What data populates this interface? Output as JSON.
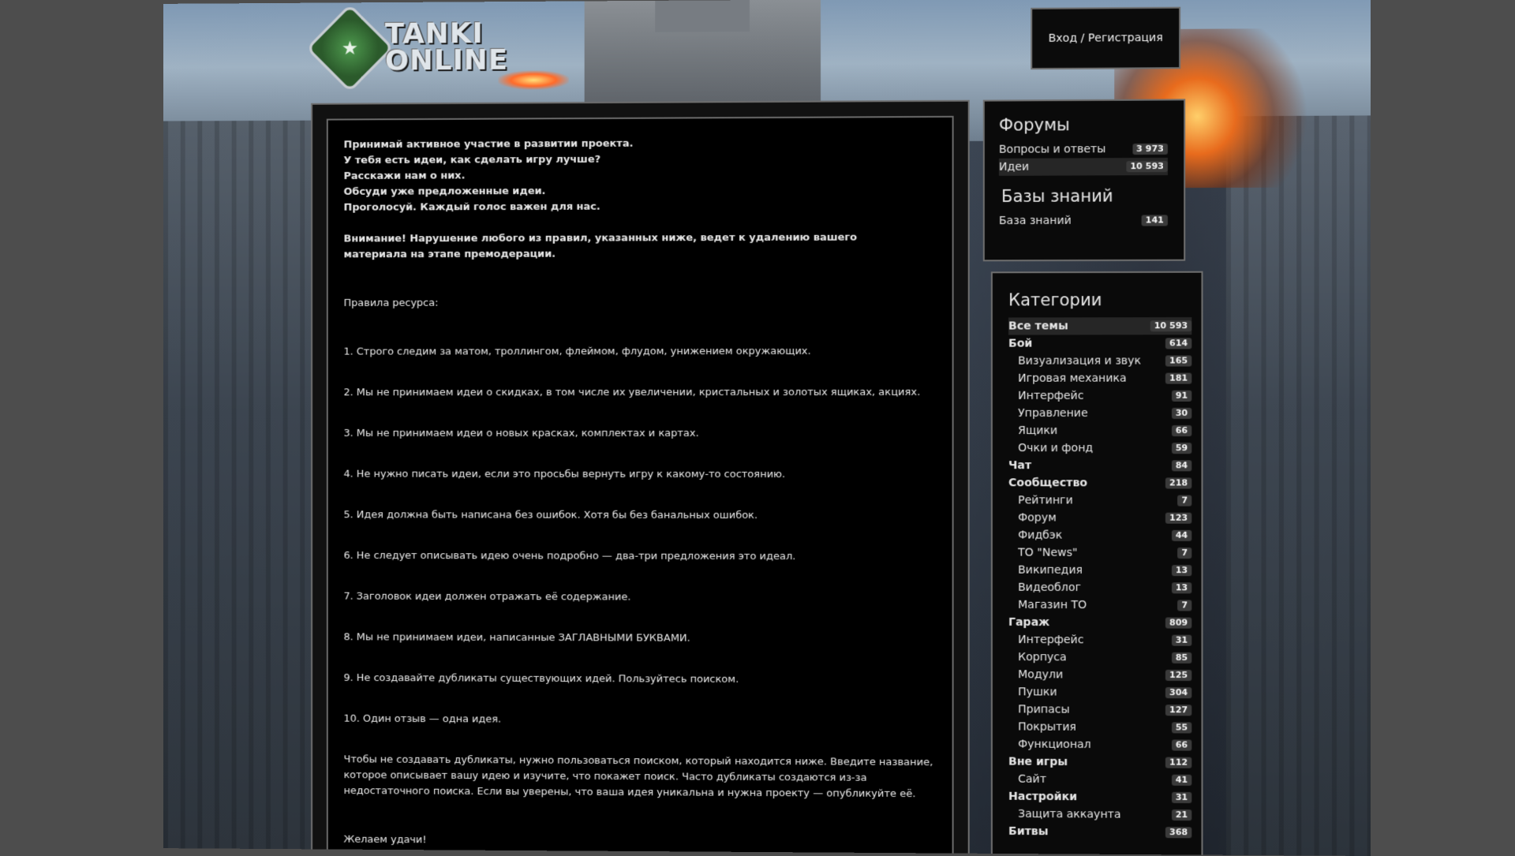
{
  "header": {
    "logo_text_line1": "TANKI",
    "logo_text_line2": "ONLINE",
    "login_label": "Вход / Регистрация"
  },
  "main": {
    "intro": [
      "Принимай активное участие в развитии проекта.",
      "У тебя есть идеи, как сделать игру лучше?",
      "Расскажи нам о них.",
      "Обсуди уже предложенные идеи.",
      "Проголосуй. Каждый голос важен для нас."
    ],
    "warning": "Внимание! Нарушение любого из правил, указанных ниже, ведет к удалению вашего материала на этапе премодерации.",
    "rules_title": "Правила ресурса:",
    "rules": [
      "1. Строго следим за матом, троллингом, флеймом, флудом, унижением окружающих.",
      "2. Мы не принимаем идеи о скидках, в том числе их увеличении, кристальных и золотых ящиках, акциях.",
      "3. Мы не принимаем идеи о новых красках, комплектах и картах.",
      "4. Не нужно писать идеи, если это просьбы вернуть игру к какому-то состоянию.",
      "5. Идея должна быть написана без ошибок. Хотя бы без банальных ошибок.",
      "6. Не следует описывать идею очень подробно — два-три предложения это идеал.",
      "7. Заголовок идеи должен отражать её содержание.",
      "8. Мы не принимаем идеи, написанные ЗАГЛАВНЫМИ БУКВАМИ.",
      "9. Не создавайте дубликаты существующих идей. Пользуйтесь поиском.",
      "10. Один отзыв — одна идея."
    ],
    "note": "Чтобы не создавать дубликаты, нужно пользоваться поиском, который находится ниже. Введите название, которое описывает вашу идею и изучите, что покажет поиск. Часто дубликаты создаются из-за недостаточного поиска. Если вы уверены, что ваша идея уникальна и нужна проекту — опубликуйте её.",
    "farewell": "Желаем удачи!"
  },
  "forums": {
    "title": "Форумы",
    "items": [
      {
        "label": "Вопросы и ответы",
        "count": "3 973"
      },
      {
        "label": "Идеи",
        "count": "10 593"
      }
    ],
    "kb_title": "Базы знаний",
    "kb_items": [
      {
        "label": "База знаний",
        "count": "141"
      }
    ]
  },
  "categories": {
    "title": "Категории",
    "items": [
      {
        "label": "Все темы",
        "count": "10 593"
      },
      {
        "label": "Бой",
        "count": "614"
      },
      {
        "label": "Визуализация и звук",
        "count": "165"
      },
      {
        "label": "Игровая механика",
        "count": "181"
      },
      {
        "label": "Интерфейс",
        "count": "91"
      },
      {
        "label": "Управление",
        "count": "30"
      },
      {
        "label": "Ящики",
        "count": "66"
      },
      {
        "label": "Очки и фонд",
        "count": "59"
      },
      {
        "label": "Чат",
        "count": "84"
      },
      {
        "label": "Сообщество",
        "count": "218"
      },
      {
        "label": "Рейтинги",
        "count": "7"
      },
      {
        "label": "Форум",
        "count": "123"
      },
      {
        "label": "Фидбэк",
        "count": "44"
      },
      {
        "label": "ТО \"News\"",
        "count": "7"
      },
      {
        "label": "Википедия",
        "count": "13"
      },
      {
        "label": "Видеоблог",
        "count": "13"
      },
      {
        "label": "Магазин ТО",
        "count": "7"
      },
      {
        "label": "Гараж",
        "count": "809"
      },
      {
        "label": "Интерфейс",
        "count": "31"
      },
      {
        "label": "Корпуса",
        "count": "85"
      },
      {
        "label": "Модули",
        "count": "125"
      },
      {
        "label": "Пушки",
        "count": "304"
      },
      {
        "label": "Припасы",
        "count": "127"
      },
      {
        "label": "Покрытия",
        "count": "55"
      },
      {
        "label": "Функционал",
        "count": "66"
      },
      {
        "label": "Вне игры",
        "count": "112"
      },
      {
        "label": "Сайт",
        "count": "41"
      },
      {
        "label": "Настройки",
        "count": "31"
      },
      {
        "label": "Защита аккаунта",
        "count": "21"
      },
      {
        "label": "Битвы",
        "count": "368"
      }
    ]
  }
}
